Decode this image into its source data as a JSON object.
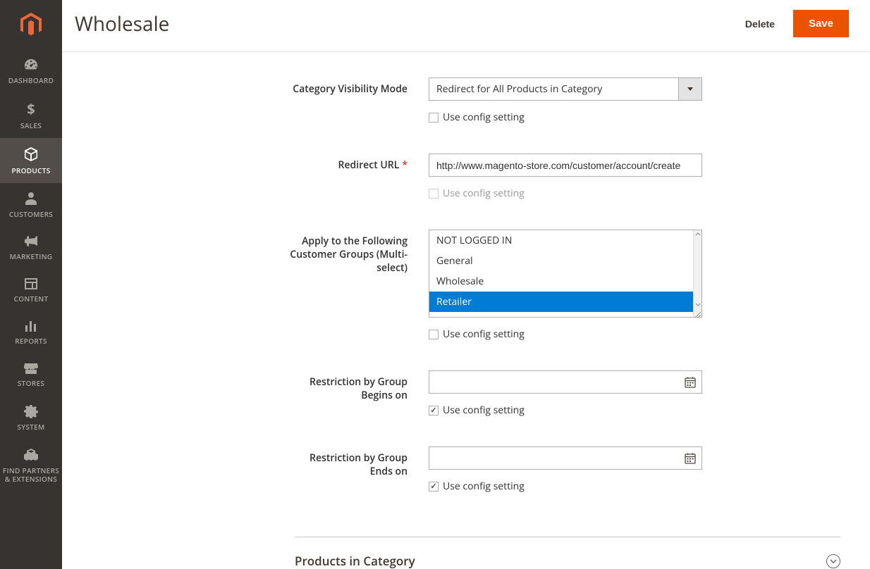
{
  "sidebar": {
    "items": [
      {
        "label": "DASHBOARD"
      },
      {
        "label": "SALES"
      },
      {
        "label": "PRODUCTS"
      },
      {
        "label": "CUSTOMERS"
      },
      {
        "label": "MARKETING"
      },
      {
        "label": "CONTENT"
      },
      {
        "label": "REPORTS"
      },
      {
        "label": "STORES"
      },
      {
        "label": "SYSTEM"
      },
      {
        "label": "FIND PARTNERS & EXTENSIONS"
      }
    ]
  },
  "header": {
    "title": "Wholesale",
    "delete": "Delete",
    "save": "Save"
  },
  "form": {
    "visibility": {
      "label": "Category Visibility Mode",
      "value": "Redirect for All Products in Category",
      "useCfg": "Use config setting"
    },
    "redirect": {
      "label": "Redirect URL",
      "value": "http://www.magento-store.com/customer/account/create",
      "useCfg": "Use config setting"
    },
    "groups": {
      "label": "Apply to the Following Customer Groups (Multi-select)",
      "options": [
        "NOT LOGGED IN",
        "General",
        "Wholesale",
        "Retailer"
      ],
      "useCfg": "Use config setting"
    },
    "begins": {
      "label": "Restriction by Group Begins on",
      "useCfg": "Use config setting"
    },
    "ends": {
      "label": "Restriction by Group Ends on",
      "useCfg": "Use config setting"
    }
  },
  "section": {
    "title": "Products in Category"
  }
}
